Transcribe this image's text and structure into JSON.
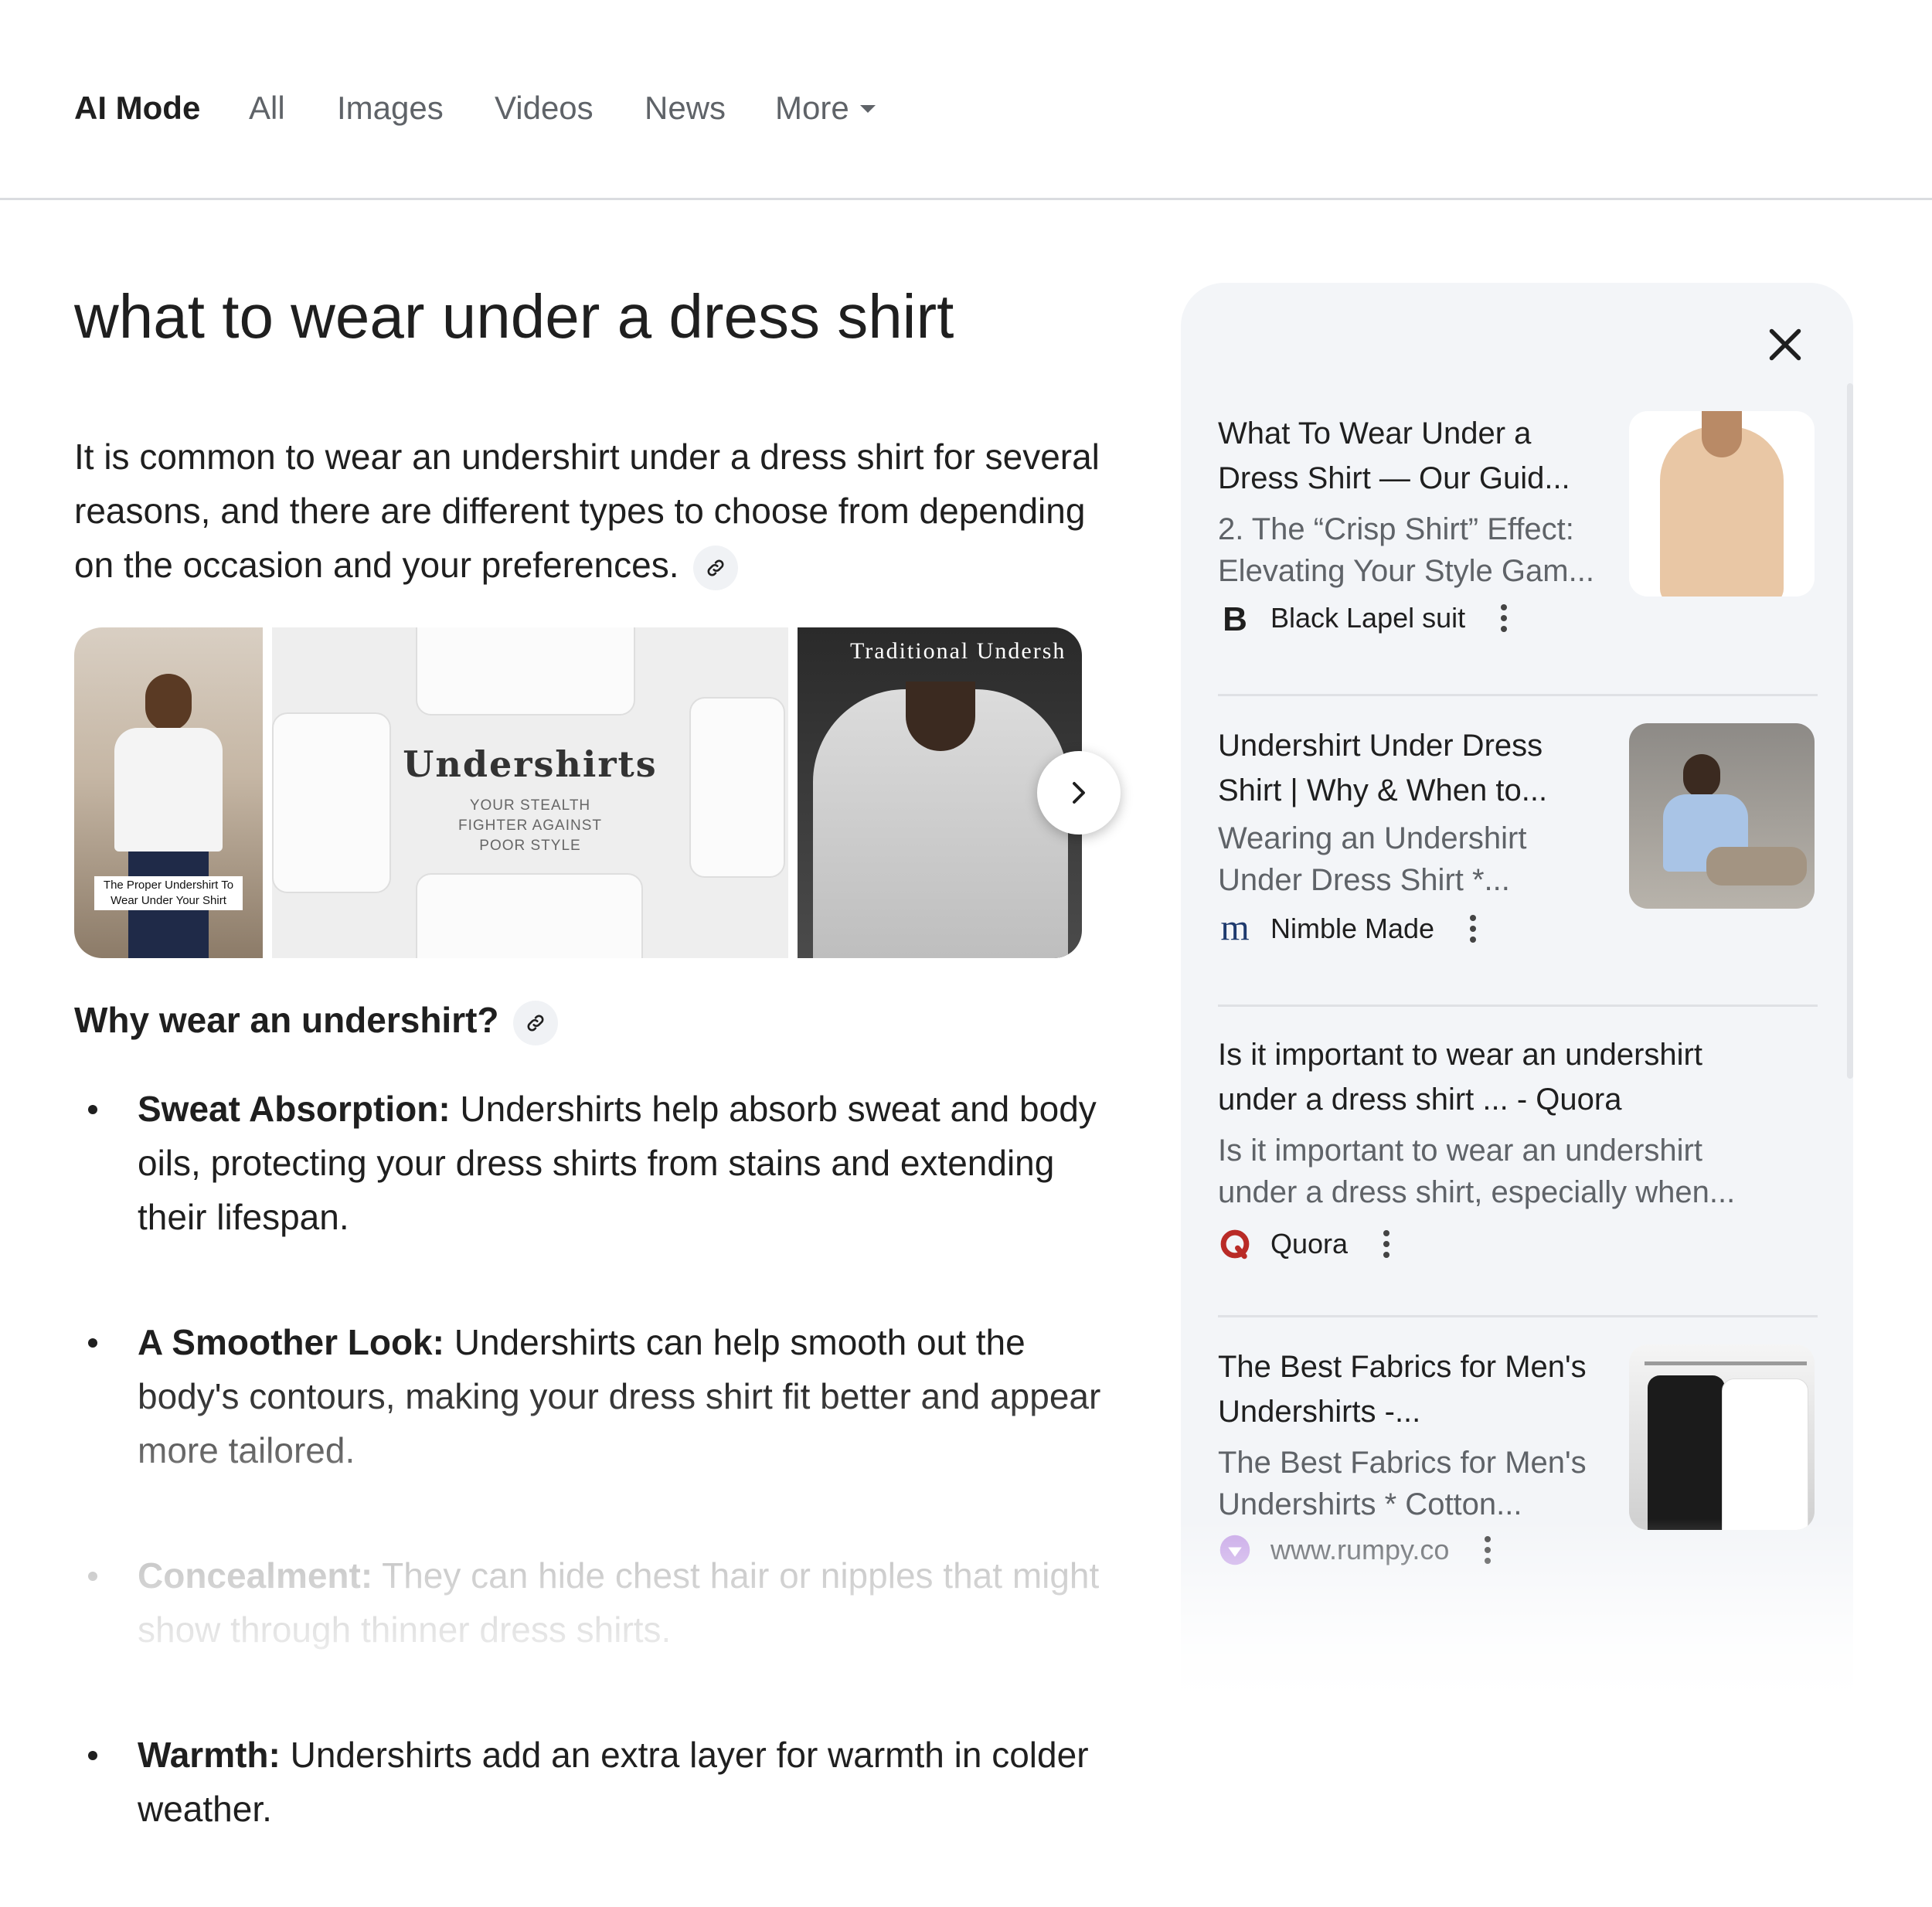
{
  "nav": {
    "tabs": [
      {
        "label": "AI Mode",
        "active": true
      },
      {
        "label": "All"
      },
      {
        "label": "Images"
      },
      {
        "label": "Videos"
      },
      {
        "label": "News"
      },
      {
        "label": "More"
      }
    ]
  },
  "main": {
    "query": "what to wear under a dress shirt",
    "intro": "It is common to wear an undershirt under a dress shirt for several reasons, and there are different types to choose from depending on the occasion and your preferences.",
    "images": {
      "img1_caption": "The Proper Undershirt To Wear Under Your Shirt",
      "img2_title": "Undershirts",
      "img2_subtitle": "YOUR STEALTH FIGHTER AGAINST POOR STYLE",
      "img3_title": "Traditional Undersh"
    },
    "subheading": "Why wear an undershirt?",
    "bullets": [
      {
        "bold": "Sweat Absorption:",
        "text": " Undershirts help absorb sweat and body oils, protecting your dress shirts from stains and extending their lifespan."
      },
      {
        "bold": "A Smoother Look:",
        "text": " Undershirts can help smooth out the body's contours, making your dress shirt fit better and appear more tailored."
      },
      {
        "bold": "Concealment:",
        "text": " They can hide chest hair or nipples that might show through thinner dress shirts."
      },
      {
        "bold": "Warmth:",
        "text": " Undershirts add an extra layer for warmth in colder weather."
      }
    ]
  },
  "sources": {
    "cards": [
      {
        "title": "What To Wear Under a Dress Shirt — Our Guid...",
        "snippet": "2. The “Crisp Shirt” Effect: Elevating Your Style Gam...",
        "source": "Black Lapel suit",
        "favicon": "letter-b-icon"
      },
      {
        "title": "Undershirt Under Dress Shirt | Why & When to...",
        "snippet": "Wearing an Undershirt Under Dress Shirt *...",
        "source": "Nimble Made",
        "favicon": "letter-m-icon"
      },
      {
        "title": "Is it important to wear an undershirt under a dress shirt ... - Quora",
        "snippet": "Is it important to wear an undershirt under a dress shirt, especially when...",
        "source": "Quora",
        "favicon": "quora-icon"
      },
      {
        "title": "The Best Fabrics for Men's Undershirts -...",
        "snippet": "The Best Fabrics for Men's Undershirts * Cotton...",
        "source": "www.rumpy.co",
        "favicon": "globe-icon"
      }
    ]
  },
  "colors": {
    "text": "#1f1f1f",
    "muted": "#5f6368",
    "panel_bg": "#f3f5f8",
    "quora": "#b92b27"
  }
}
